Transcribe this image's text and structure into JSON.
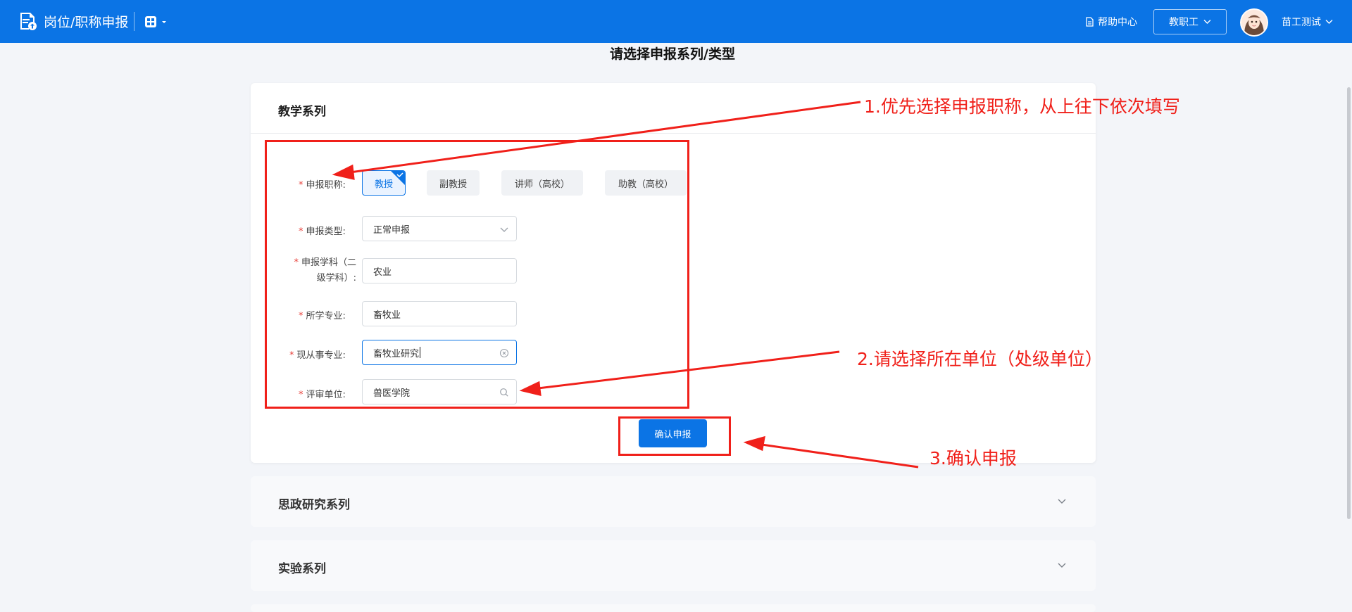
{
  "header": {
    "app_title": "岗位/职称申报",
    "help_label": "帮助中心",
    "role_label": "教职工",
    "user_name": "苗工测试"
  },
  "page": {
    "title": "请选择申报系列/类型"
  },
  "teaching_series": {
    "title": "教学系列",
    "form": {
      "required_mark": "*",
      "title_label": "申报职称:",
      "title_options": [
        "教授",
        "副教授",
        "讲师（高校）",
        "助教（高校）"
      ],
      "selected_title": "教授",
      "type_label": "申报类型:",
      "type_value": "正常申报",
      "subject_label": "申报学科（二级学科）:",
      "subject_value": "农业",
      "major_label": "所学专业:",
      "major_value": "畜牧业",
      "current_major_label": "现从事专业:",
      "current_major_value": "畜牧业研究",
      "unit_label": "评审单位:",
      "unit_value": "兽医学院"
    },
    "submit_label": "确认申报"
  },
  "collapsed_series": [
    {
      "title": "思政研究系列"
    },
    {
      "title": "实验系列"
    }
  ],
  "annotations": {
    "step1": "1.优先选择申报职称，从上往下依次填写",
    "step2": "2.请选择所在单位（处级单位）",
    "step3": "3.确认申报"
  },
  "colors": {
    "primary": "#0b74e5",
    "annotation_red": "#f0201a",
    "required_red": "#e8413b",
    "page_bg": "#f3f5f9"
  },
  "icons": {
    "logo": "document-upload-icon",
    "apps": "apps-grid-icon",
    "help": "document-icon",
    "dropdown": "chevron-down-icon",
    "clear": "clear-circle-icon",
    "search": "search-icon",
    "selected": "check-corner-icon"
  }
}
